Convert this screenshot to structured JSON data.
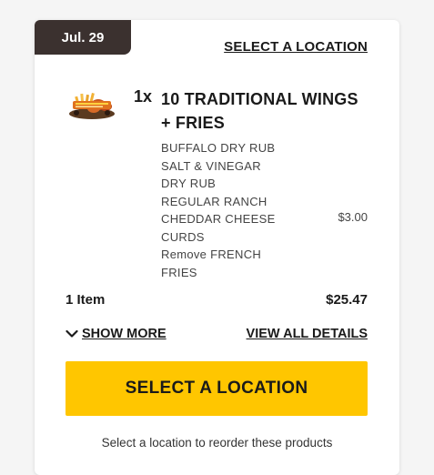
{
  "order": {
    "date": "Jul. 29",
    "select_location_link": "SELECT A LOCATION",
    "item": {
      "quantity": "1x",
      "name": "10 TRADITIONAL WINGS + FRIES",
      "modifiers": [
        "BUFFALO DRY RUB",
        "SALT & VINEGAR DRY RUB",
        "REGULAR RANCH",
        "CHEDDAR CHEESE CURDS",
        "Remove FRENCH FRIES"
      ],
      "modifier_price": "$3.00"
    },
    "item_count": "1 Item",
    "total": "$25.47",
    "show_more": "SHOW MORE",
    "view_all_details": "VIEW ALL DETAILS",
    "cta_label": "SELECT A LOCATION",
    "hint": "Select a location to reorder these products"
  },
  "colors": {
    "date_tab": "#3b312f",
    "cta": "#ffc600",
    "card": "#ffffff"
  },
  "icons": {
    "show_more": "chevron-down-icon",
    "product": "wings-and-fries-image"
  }
}
